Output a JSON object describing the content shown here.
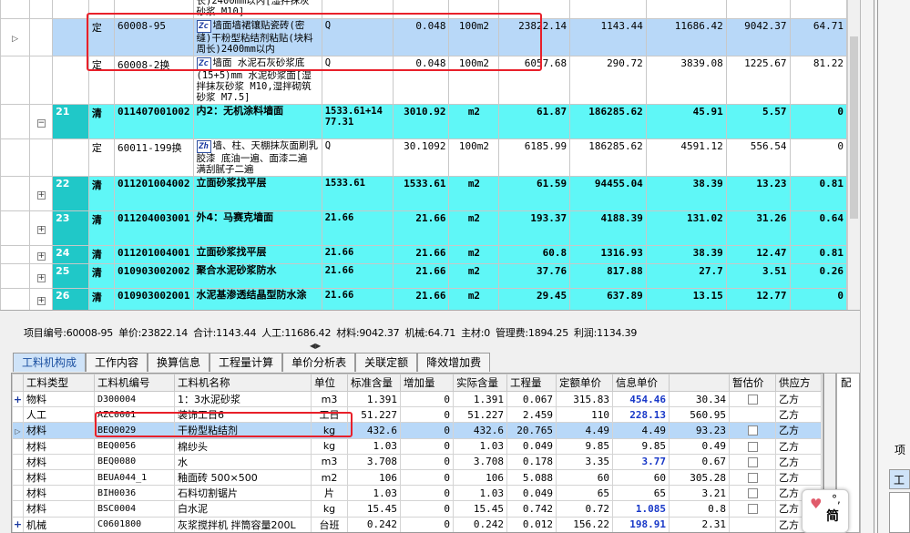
{
  "upper_rows": [
    {
      "kind": "ding",
      "indicator": "",
      "expand": "",
      "idx": "",
      "type": "定",
      "code": "60008-95",
      "icon": "Zc",
      "name": "墙面墙裙镶贴瓷砖(密缝)干粉型粘结剂粘贴(块料周长)2400mm以内",
      "qty_expr": "Q",
      "qty": "0.048",
      "unit": "100m2",
      "price": "23822.14",
      "total": "1143.44",
      "labor": "11686.42",
      "material": "9042.37",
      "machine": "64.71",
      "selected": true
    },
    {
      "kind": "ding",
      "indicator": "",
      "expand": "",
      "idx": "",
      "type": "定",
      "code": "60008-2换",
      "icon": "Zc",
      "name": "墙面 水泥石灰砂浆底(15+5)mm 水泥砂浆面[湿拌抹灰砂浆 M10,湿拌砌筑砂浆 M7.5]",
      "qty_expr": "Q",
      "qty": "0.048",
      "unit": "100m2",
      "price": "6057.68",
      "total": "290.72",
      "labor": "3839.08",
      "material": "1225.67",
      "machine": "81.22",
      "selected": false
    },
    {
      "kind": "qing",
      "indicator": "",
      "expand": "⊟",
      "idx": "21",
      "type": "清",
      "code": "011407001002",
      "icon": "",
      "name": "内2：无机涂料墙面",
      "qty_expr": "1533.61+14 77.31",
      "qty": "3010.92",
      "unit": "m2",
      "price": "61.87",
      "total": "186285.62",
      "labor": "45.91",
      "material": "5.57",
      "machine": "0",
      "selected": false
    },
    {
      "kind": "ding",
      "indicator": "",
      "expand": "",
      "idx": "",
      "type": "定",
      "code": "60011-199换",
      "icon": "Zh",
      "name": "墙、柱、天棚抹灰面刷乳胶漆 底油一遍、面漆二遍 满刮腻子二遍",
      "qty_expr": "Q",
      "qty": "30.1092",
      "unit": "100m2",
      "price": "6185.99",
      "total": "186285.62",
      "labor": "4591.12",
      "material": "556.54",
      "machine": "0",
      "selected": false
    },
    {
      "kind": "qing",
      "indicator": "",
      "expand": "⊞",
      "idx": "22",
      "type": "清",
      "code": "011201004002",
      "icon": "",
      "name": "立面砂浆找平层",
      "qty_expr": "1533.61",
      "qty": "1533.61",
      "unit": "m2",
      "price": "61.59",
      "total": "94455.04",
      "labor": "38.39",
      "material": "13.23",
      "machine": "0.81",
      "selected": false
    },
    {
      "kind": "qing",
      "indicator": "",
      "expand": "⊞",
      "idx": "23",
      "type": "清",
      "code": "011204003001",
      "icon": "",
      "name": "外4：马赛克墙面",
      "qty_expr": "21.66",
      "qty": "21.66",
      "unit": "m2",
      "price": "193.37",
      "total": "4188.39",
      "labor": "131.02",
      "material": "31.26",
      "machine": "0.64",
      "selected": false
    },
    {
      "kind": "qing",
      "indicator": "",
      "expand": "⊞",
      "idx": "24",
      "type": "清",
      "code": "011201004001",
      "icon": "",
      "name": "立面砂浆找平层",
      "qty_expr": "21.66",
      "qty": "21.66",
      "unit": "m2",
      "price": "60.8",
      "total": "1316.93",
      "labor": "38.39",
      "material": "12.47",
      "machine": "0.81",
      "selected": false
    },
    {
      "kind": "qing",
      "indicator": "",
      "expand": "⊞",
      "idx": "25",
      "type": "清",
      "code": "010903002002",
      "icon": "",
      "name": "聚合水泥砂浆防水",
      "qty_expr": "21.66",
      "qty": "21.66",
      "unit": "m2",
      "price": "37.76",
      "total": "817.88",
      "labor": "27.7",
      "material": "3.51",
      "machine": "0.26",
      "selected": false
    },
    {
      "kind": "qing",
      "indicator": "",
      "expand": "⊞",
      "idx": "26",
      "type": "清",
      "code": "010903002001",
      "icon": "",
      "name": "水泥基渗透结晶型防水涂",
      "qty_expr": "21.66",
      "qty": "21.66",
      "unit": "m2",
      "price": "29.45",
      "total": "637.89",
      "labor": "13.15",
      "material": "12.77",
      "machine": "0",
      "selected": false
    }
  ],
  "top_partial": {
    "name": "长)2400mm以内[湿拌抹灰砂浆 M10]"
  },
  "summary": [
    "项目编号:60008-95",
    "单价:23822.14",
    "合计:1143.44",
    "人工:11686.42",
    "材料:9042.37",
    "机械:64.71",
    "主材:0",
    "管理费:1894.25",
    "利润:1134.39"
  ],
  "tabs": [
    "工料机构成",
    "工作内容",
    "换算信息",
    "工程量计算",
    "单价分析表",
    "关联定额",
    "降效增加费"
  ],
  "lower": {
    "headers": [
      "工料类型",
      "工料机编号",
      "工料机名称",
      "单位",
      "标准含量",
      "增加量",
      "实际含量",
      "工程量",
      "定额单价",
      "信息单价",
      "",
      "暂估价",
      "供应方"
    ],
    "rows": [
      {
        "exp": "+",
        "type": "物料",
        "code": "D300004",
        "name": "1：3水泥砂浆",
        "unit": "m3",
        "std": "1.391",
        "add": "0",
        "act": "1.391",
        "qty": "0.067",
        "dprice": "315.83",
        "iprice": "454.46",
        "ip_blue": true,
        "x": "30.34",
        "chk": true,
        "supplier": "乙方",
        "sel": false
      },
      {
        "exp": "",
        "type": "人工",
        "code": "AZC0001",
        "name": "装饰工日6",
        "unit": "工日",
        "std": "51.227",
        "add": "0",
        "act": "51.227",
        "qty": "2.459",
        "dprice": "110",
        "iprice": "228.13",
        "ip_blue": true,
        "x": "560.95",
        "chk": false,
        "supplier": "乙方",
        "sel": false
      },
      {
        "exp": "",
        "type": "材料",
        "code": "BEQ0029",
        "name": "干粉型粘结剂",
        "unit": "kg",
        "std": "432.6",
        "add": "0",
        "act": "432.6",
        "qty": "20.765",
        "dprice": "4.49",
        "iprice": "4.49",
        "ip_blue": false,
        "x": "93.23",
        "chk": true,
        "supplier": "乙方",
        "sel": true
      },
      {
        "exp": "",
        "type": "材料",
        "code": "BEQ0056",
        "name": "棉纱头",
        "unit": "kg",
        "std": "1.03",
        "add": "0",
        "act": "1.03",
        "qty": "0.049",
        "dprice": "9.85",
        "iprice": "9.85",
        "ip_blue": false,
        "x": "0.49",
        "chk": true,
        "supplier": "乙方",
        "sel": false
      },
      {
        "exp": "",
        "type": "材料",
        "code": "BEQ0080",
        "name": "水",
        "unit": "m3",
        "std": "3.708",
        "add": "0",
        "act": "3.708",
        "qty": "0.178",
        "dprice": "3.35",
        "iprice": "3.77",
        "ip_blue": true,
        "x": "0.67",
        "chk": true,
        "supplier": "乙方",
        "sel": false
      },
      {
        "exp": "",
        "type": "材料",
        "code": "BEUA044_1",
        "name": "釉面砖 500×500",
        "unit": "m2",
        "std": "106",
        "add": "0",
        "act": "106",
        "qty": "5.088",
        "dprice": "60",
        "iprice": "60",
        "ip_blue": false,
        "x": "305.28",
        "chk": true,
        "supplier": "乙方",
        "sel": false
      },
      {
        "exp": "",
        "type": "材料",
        "code": "BIH0036",
        "name": "石料切割锯片",
        "unit": "片",
        "std": "1.03",
        "add": "0",
        "act": "1.03",
        "qty": "0.049",
        "dprice": "65",
        "iprice": "65",
        "ip_blue": false,
        "x": "3.21",
        "chk": true,
        "supplier": "乙方",
        "sel": false
      },
      {
        "exp": "",
        "type": "材料",
        "code": "BSC0004",
        "name": "白水泥",
        "unit": "kg",
        "std": "15.45",
        "add": "0",
        "act": "15.45",
        "qty": "0.742",
        "dprice": "0.72",
        "iprice": "1.085",
        "ip_blue": true,
        "x": "0.8",
        "chk": true,
        "supplier": "乙方",
        "sel": false
      },
      {
        "exp": "+",
        "type": "机械",
        "code": "C0601800",
        "name": "灰浆搅拌机 拌筒容量200L",
        "unit": "台班",
        "std": "0.242",
        "add": "0",
        "act": "0.242",
        "qty": "0.012",
        "dprice": "156.22",
        "iprice": "198.91",
        "ip_blue": true,
        "x": "2.31",
        "chk": false,
        "supplier": "乙方",
        "sel": false
      }
    ]
  },
  "right_pane": {
    "label1": "项",
    "tab": "工",
    "peibi": "配"
  },
  "widget": {
    "text": "简"
  },
  "colors": {
    "qing_row": "#5ff7f7",
    "selected_row": "#b8d8f8",
    "highlight": "#e8202a",
    "info_price": "#1838c8"
  }
}
